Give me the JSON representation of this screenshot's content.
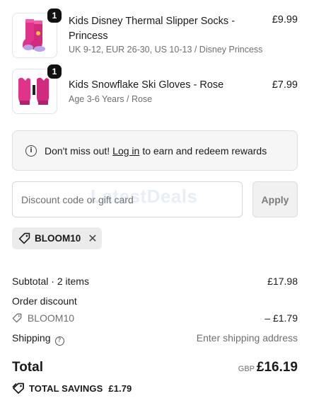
{
  "items": [
    {
      "name": "Kids Disney Thermal Slipper Socks - Princess",
      "variant": "UK 9-12, EUR 26-30, US 10-13 / Disney Princess",
      "price": "£9.99",
      "quantity": "1",
      "image_icon": "pink-socks-image"
    },
    {
      "name": "Kids Snowflake Ski Gloves - Rose",
      "variant": "Age 3-6 Years / Rose",
      "price": "£7.99",
      "quantity": "1",
      "image_icon": "pink-gloves-image"
    }
  ],
  "rewards_notice": {
    "prefix": "Don't miss out!",
    "link": "Log in",
    "suffix": "to earn and redeem rewards"
  },
  "discount": {
    "placeholder": "Discount code or gift card",
    "apply_label": "Apply",
    "applied_code": "BLOOM10"
  },
  "watermark": "LatestDeals",
  "summary": {
    "subtotal_label": "Subtotal · 2 items",
    "subtotal_value": "£17.98",
    "order_discount_label": "Order discount",
    "discount_code": "BLOOM10",
    "discount_value": "– £1.79",
    "shipping_label": "Shipping",
    "shipping_value": "Enter shipping address",
    "total_label": "Total",
    "currency": "GBP",
    "total_value": "£16.19",
    "savings_label": "TOTAL SAVINGS",
    "savings_value": "£1.79"
  },
  "colors": {
    "accent_pink": "#e0338a",
    "text": "#1a1a1a",
    "muted": "#6f6f6f",
    "badge": "#111111"
  }
}
